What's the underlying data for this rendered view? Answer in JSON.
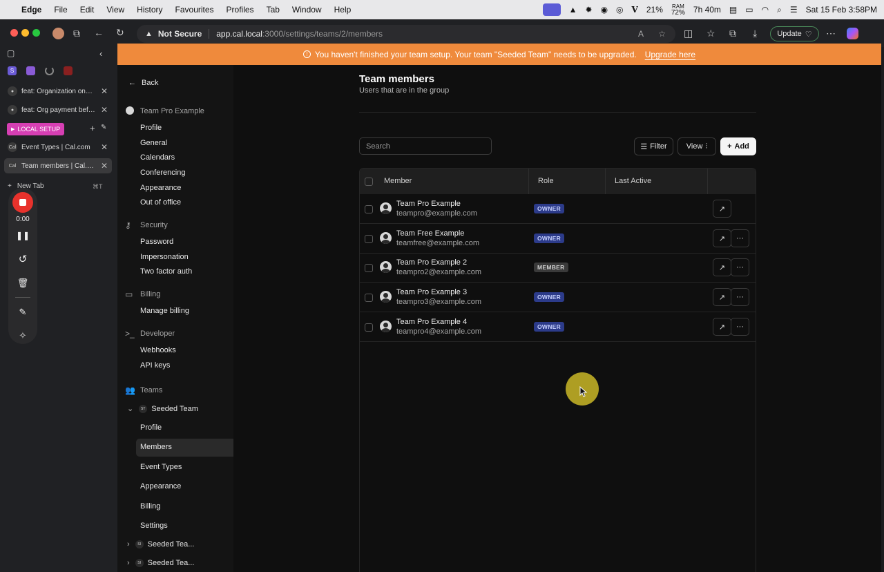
{
  "menubar": {
    "app": "Edge",
    "items": [
      "File",
      "Edit",
      "View",
      "History",
      "Favourites",
      "Profiles",
      "Tab",
      "Window",
      "Help"
    ],
    "battery_pct": "21%",
    "ram_label": "RAM",
    "ram_pct": "72%",
    "battery_time": "7h 40m",
    "datetime": "Sat 15 Feb  3:58PM"
  },
  "browser": {
    "not_secure": "Not Secure",
    "url_host": "app.cal.local",
    "url_path": ":3000/settings/teams/2/members",
    "update_label": "Update"
  },
  "tabs": {
    "pinned": [
      "S",
      "",
      "",
      ""
    ],
    "items": [
      {
        "label": "feat: Organization onboarding",
        "favicon": "github-icon"
      },
      {
        "label": "feat: Org payment before",
        "favicon": "github-icon"
      }
    ],
    "group_label": "LOCAL SETUP",
    "group_tabs": [
      {
        "label": "Event Types | Cal.com",
        "favicon": "Cal"
      },
      {
        "label": "Team members | Cal.com",
        "favicon": "Cal",
        "active": true
      }
    ],
    "new_tab": "New Tab",
    "new_tab_shortcut": "⌘T"
  },
  "recorder": {
    "time": "0:00"
  },
  "banner": {
    "message": "You haven't finished your team setup. Your team \"Seeded Team\" needs to be upgraded.",
    "link": "Upgrade here",
    "color": "#ef8a3c"
  },
  "nav": {
    "back": "Back",
    "account_header": "Team Pro Example",
    "account_items": [
      "Profile",
      "General",
      "Calendars",
      "Conferencing",
      "Appearance",
      "Out of office"
    ],
    "security_header": "Security",
    "security_items": [
      "Password",
      "Impersonation",
      "Two factor auth"
    ],
    "billing_header": "Billing",
    "billing_items": [
      "Manage billing"
    ],
    "developer_header": "Developer",
    "developer_items": [
      "Webhooks",
      "API keys"
    ],
    "teams_header": "Teams",
    "team_name": "Seeded Team",
    "team_avatar": "ST",
    "team_items": [
      "Profile",
      "Members",
      "Event Types",
      "Appearance",
      "Billing",
      "Settings"
    ],
    "other_teams": [
      {
        "name": "Seeded Tea...",
        "avatar": "SI"
      },
      {
        "name": "Seeded Tea...",
        "avatar": "SI"
      }
    ]
  },
  "main": {
    "title": "Team members",
    "subtitle": "Users that are in the group",
    "search_placeholder": "Search",
    "filter_label": "Filter",
    "view_label": "View",
    "add_label": "Add",
    "columns": [
      "Member",
      "Role",
      "Last Active"
    ],
    "members": [
      {
        "name": "Team Pro Example",
        "email": "teampro@example.com",
        "role": "OWNER",
        "has_menu": false
      },
      {
        "name": "Team Free Example",
        "email": "teamfree@example.com",
        "role": "OWNER",
        "has_menu": true
      },
      {
        "name": "Team Pro Example 2",
        "email": "teampro2@example.com",
        "role": "MEMBER",
        "has_menu": true
      },
      {
        "name": "Team Pro Example 3",
        "email": "teampro3@example.com",
        "role": "OWNER",
        "has_menu": true
      },
      {
        "name": "Team Pro Example 4",
        "email": "teampro4@example.com",
        "role": "OWNER",
        "has_menu": true
      }
    ]
  }
}
